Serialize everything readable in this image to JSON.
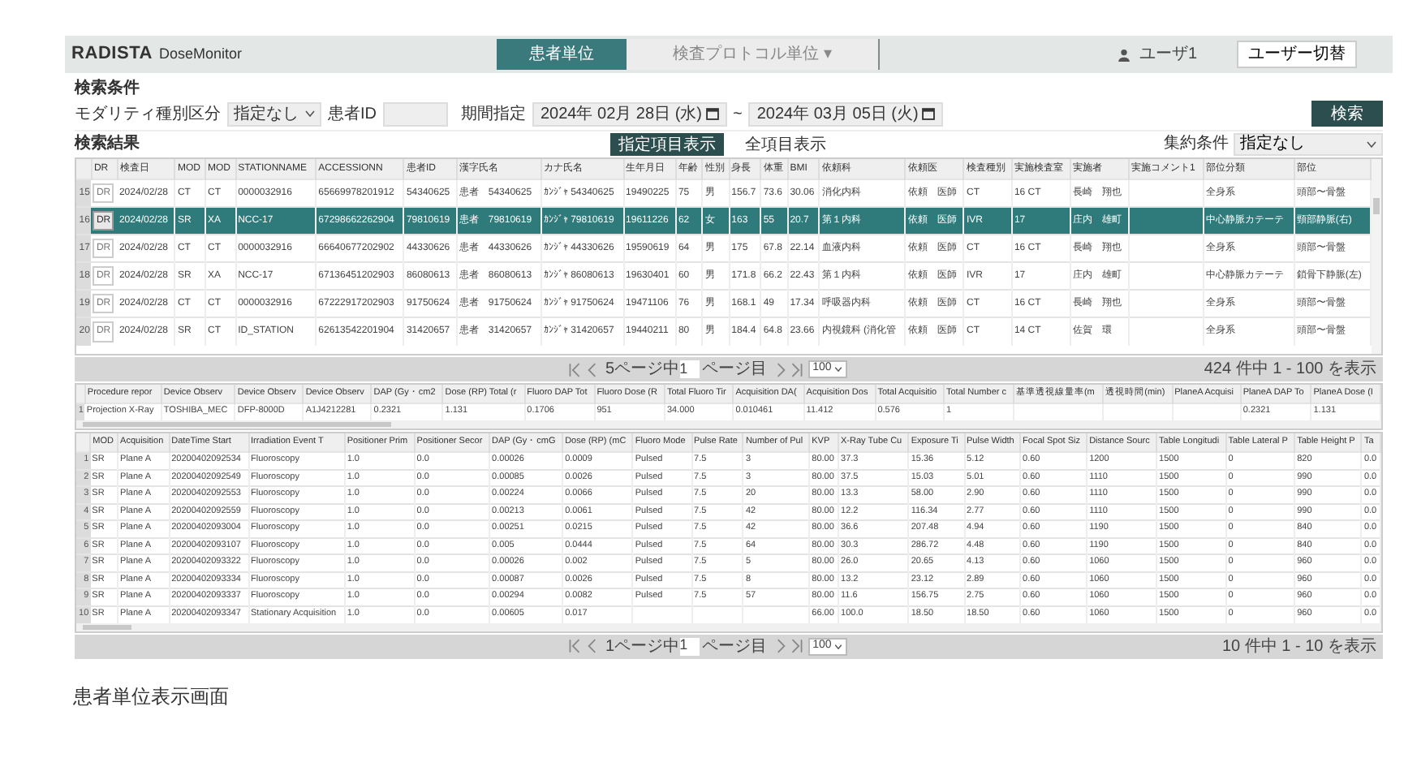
{
  "header": {
    "logo_mark": "RADISTA",
    "app_name": "DoseMonitor",
    "tabs": [
      {
        "label": "患者単位",
        "selected": true
      },
      {
        "label": "検査プロトコル単位 ▾",
        "selected": false
      }
    ],
    "user": "ユーザ1",
    "switch_user_button": "ユーザー切替"
  },
  "search": {
    "title": "検索条件",
    "modality_label": "モダリティ種別区分",
    "modality_value": "指定なし",
    "patient_id_label": "患者ID",
    "period_label": "期間指定",
    "date_from": "2024年 02月 28日 (水)",
    "separator": "~",
    "date_to": "2024年 03月 05日 (火)",
    "search_button": "検索"
  },
  "results": {
    "title": "検索結果",
    "view_toggles": [
      {
        "label": "指定項目表示",
        "selected": true
      },
      {
        "label": "全項目表示",
        "selected": false
      }
    ],
    "aggregate_label": "集約条件",
    "aggregate_value": "指定なし"
  },
  "exam_table": {
    "columns": [
      "",
      "DR",
      "検査日",
      "MOD",
      "MOD",
      "STATIONNAME",
      "ACCESSIONN",
      "患者ID",
      "漢字氏名",
      "カナ氏名",
      "生年月日",
      "年齢",
      "性別",
      "身長",
      "体重",
      "BMI",
      "依頼科",
      "依頼医",
      "検査種別",
      "実施検査室",
      "実施者",
      "実施コメント1",
      "部位分類",
      "部位"
    ],
    "rows": [
      {
        "selected": false,
        "cells": [
          "15",
          "DR",
          "2024/02/28",
          "CT",
          "CT",
          "0000032916",
          "65669978201912",
          "54340625",
          "患者　54340625",
          "ｶﾝｼﾞｬ 54340625",
          "19490225",
          "75",
          "男",
          "156.7",
          "73.6",
          "30.06",
          "消化内科",
          "依頼　医師",
          "CT",
          "16 CT",
          "長崎　翔也",
          "",
          "全身系",
          "頭部〜骨盤"
        ]
      },
      {
        "selected": true,
        "cells": [
          "16",
          "DR",
          "2024/02/28",
          "SR",
          "XA",
          "NCC-17",
          "67298662262904",
          "79810619",
          "患者　79810619",
          "ｶﾝｼﾞｬ 79810619",
          "19611226",
          "62",
          "女",
          "163",
          "55",
          "20.7",
          "第１内科",
          "依頼　医師",
          "IVR",
          "17",
          "庄内　雄町",
          "",
          "中心静脈カテーテ",
          "頸部静脈(右)"
        ]
      },
      {
        "selected": false,
        "cells": [
          "17",
          "DR",
          "2024/02/28",
          "CT",
          "CT",
          "0000032916",
          "66640677202902",
          "44330626",
          "患者　44330626",
          "ｶﾝｼﾞｬ 44330626",
          "19590619",
          "64",
          "男",
          "175",
          "67.8",
          "22.14",
          "血液内科",
          "依頼　医師",
          "CT",
          "16 CT",
          "長崎　翔也",
          "",
          "全身系",
          "頭部〜骨盤"
        ]
      },
      {
        "selected": false,
        "cells": [
          "18",
          "DR",
          "2024/02/28",
          "SR",
          "XA",
          "NCC-17",
          "67136451202903",
          "86080613",
          "患者　86080613",
          "ｶﾝｼﾞｬ 86080613",
          "19630401",
          "60",
          "男",
          "171.8",
          "66.2",
          "22.43",
          "第１内科",
          "依頼　医師",
          "IVR",
          "17",
          "庄内　雄町",
          "",
          "中心静脈カテーテ",
          "鎖骨下静脈(左)"
        ]
      },
      {
        "selected": false,
        "cells": [
          "19",
          "DR",
          "2024/02/28",
          "CT",
          "CT",
          "0000032916",
          "67222917202903",
          "91750624",
          "患者　91750624",
          "ｶﾝｼﾞｬ 91750624",
          "19471106",
          "76",
          "男",
          "168.1",
          "49",
          "17.34",
          "呼吸器内科",
          "依頼　医師",
          "CT",
          "16 CT",
          "長崎　翔也",
          "",
          "全身系",
          "頭部〜骨盤"
        ]
      },
      {
        "selected": false,
        "cells": [
          "20",
          "DR",
          "2024/02/28",
          "SR",
          "CT",
          "ID_STATION",
          "62613542201904",
          "31420657",
          "患者　31420657",
          "ｶﾝｼﾞｬ 31420657",
          "19440211",
          "80",
          "男",
          "184.4",
          "64.8",
          "23.66",
          "内視鏡科 (消化管",
          "依頼　医師",
          "CT",
          "14 CT",
          "佐賀　環",
          "",
          "全身系",
          "頭部〜骨盤"
        ]
      }
    ]
  },
  "exam_pager": {
    "page_info": "5ページ中",
    "page": "1",
    "page_suffix": "ページ目",
    "page_size": "100",
    "summary": "424 件中 1 - 100 を表示"
  },
  "procedure_table": {
    "columns": [
      "",
      "Procedure repor",
      "Device Observ",
      "Device Observ",
      "Device Observ",
      "DAP (Gy・cm2",
      "Dose (RP) Total (r",
      "Fluoro DAP Tot",
      "Fluoro Dose (R",
      "Total Fluoro Tir",
      "Acquisition DA(",
      "Acquisition Dos",
      "Total Acquisitio",
      "Total Number c",
      "基準透視線量率(m",
      "透視時間(min)",
      "PlaneA Acquisi",
      "PlaneA DAP To",
      "PlaneA Dose (I"
    ],
    "rows": [
      {
        "cells": [
          "1",
          "Projection X-Ray",
          "TOSHIBA_MEC",
          "DFP-8000D",
          "A1J4212281",
          "0.2321",
          "1.131",
          "0.1706",
          "951",
          "34.000",
          "0.010461",
          "11.412",
          "0.576",
          "1",
          "",
          "",
          "",
          "0.2321",
          "1.131"
        ]
      }
    ]
  },
  "event_table": {
    "columns": [
      "",
      "MOD",
      "Acquisition",
      "DateTime Start",
      "Irradiation Event T",
      "Positioner Prim",
      "Positioner Secor",
      "DAP (Gy・cmG",
      "Dose (RP) (mC",
      "Fluoro Mode",
      "Pulse Rate",
      "Number of Pul",
      "KVP",
      "X-Ray Tube Cu",
      "Exposure Ti",
      "Pulse Width",
      "Focal Spot Siz",
      "Distance Sourc",
      "Table Longitudi",
      "Table Lateral P",
      "Table Height P",
      "Ta"
    ],
    "rows": [
      {
        "cells": [
          "1",
          "SR",
          "Plane A",
          "20200402092534",
          "Fluoroscopy",
          "1.0",
          "0.0",
          "0.00026",
          "0.0009",
          "Pulsed",
          "7.5",
          "3",
          "80.00",
          "37.3",
          "15.36",
          "5.12",
          "0.60",
          "1200",
          "1500",
          "0",
          "820",
          "0.0"
        ]
      },
      {
        "cells": [
          "2",
          "SR",
          "Plane A",
          "20200402092549",
          "Fluoroscopy",
          "1.0",
          "0.0",
          "0.00085",
          "0.0026",
          "Pulsed",
          "7.5",
          "3",
          "80.00",
          "37.5",
          "15.03",
          "5.01",
          "0.60",
          "1110",
          "1500",
          "0",
          "990",
          "0.0"
        ]
      },
      {
        "cells": [
          "3",
          "SR",
          "Plane A",
          "20200402092553",
          "Fluoroscopy",
          "1.0",
          "0.0",
          "0.00224",
          "0.0066",
          "Pulsed",
          "7.5",
          "20",
          "80.00",
          "13.3",
          "58.00",
          "2.90",
          "0.60",
          "1110",
          "1500",
          "0",
          "990",
          "0.0"
        ]
      },
      {
        "cells": [
          "4",
          "SR",
          "Plane A",
          "20200402092559",
          "Fluoroscopy",
          "1.0",
          "0.0",
          "0.00213",
          "0.0061",
          "Pulsed",
          "7.5",
          "42",
          "80.00",
          "12.2",
          "116.34",
          "2.77",
          "0.60",
          "1110",
          "1500",
          "0",
          "990",
          "0.0"
        ]
      },
      {
        "cells": [
          "5",
          "SR",
          "Plane A",
          "20200402093004",
          "Fluoroscopy",
          "1.0",
          "0.0",
          "0.00251",
          "0.0215",
          "Pulsed",
          "7.5",
          "42",
          "80.00",
          "36.6",
          "207.48",
          "4.94",
          "0.60",
          "1190",
          "1500",
          "0",
          "840",
          "0.0"
        ]
      },
      {
        "cells": [
          "6",
          "SR",
          "Plane A",
          "20200402093107",
          "Fluoroscopy",
          "1.0",
          "0.0",
          "0.005",
          "0.0444",
          "Pulsed",
          "7.5",
          "64",
          "80.00",
          "30.3",
          "286.72",
          "4.48",
          "0.60",
          "1190",
          "1500",
          "0",
          "840",
          "0.0"
        ]
      },
      {
        "cells": [
          "7",
          "SR",
          "Plane A",
          "20200402093322",
          "Fluoroscopy",
          "1.0",
          "0.0",
          "0.00026",
          "0.002",
          "Pulsed",
          "7.5",
          "5",
          "80.00",
          "26.0",
          "20.65",
          "4.13",
          "0.60",
          "1060",
          "1500",
          "0",
          "960",
          "0.0"
        ]
      },
      {
        "cells": [
          "8",
          "SR",
          "Plane A",
          "20200402093334",
          "Fluoroscopy",
          "1.0",
          "0.0",
          "0.00087",
          "0.0026",
          "Pulsed",
          "7.5",
          "8",
          "80.00",
          "13.2",
          "23.12",
          "2.89",
          "0.60",
          "1060",
          "1500",
          "0",
          "960",
          "0.0"
        ]
      },
      {
        "cells": [
          "9",
          "SR",
          "Plane A",
          "20200402093337",
          "Fluoroscopy",
          "1.0",
          "0.0",
          "0.00294",
          "0.0082",
          "Pulsed",
          "7.5",
          "57",
          "80.00",
          "11.6",
          "156.75",
          "2.75",
          "0.60",
          "1060",
          "1500",
          "0",
          "960",
          "0.0"
        ]
      },
      {
        "cells": [
          "10",
          "SR",
          "Plane A",
          "20200402093347",
          "Stationary Acquisition",
          "1.0",
          "0.0",
          "0.00605",
          "0.017",
          "",
          "",
          "",
          "66.00",
          "100.0",
          "18.50",
          "18.50",
          "0.60",
          "1060",
          "1500",
          "0",
          "960",
          "0.0"
        ]
      }
    ]
  },
  "event_pager": {
    "page_info": "1ページ中",
    "page": "1",
    "page_suffix": "ページ目",
    "page_size": "100",
    "summary": "10 件中 1 - 10 を表示"
  },
  "caption": "患者単位表示画面"
}
